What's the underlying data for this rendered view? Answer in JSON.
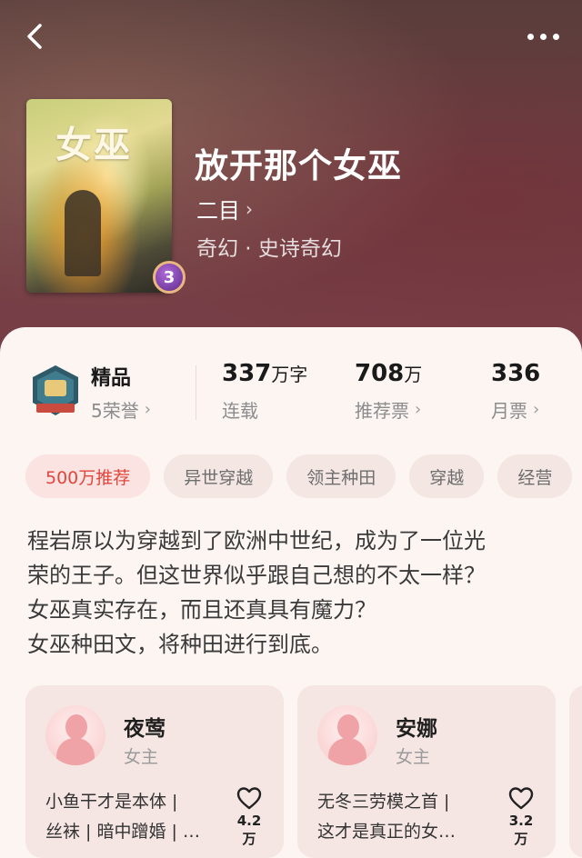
{
  "header": {
    "back_icon": "chevron-left-icon",
    "more_icon": "more-dots-icon"
  },
  "book": {
    "cover_title": "女巫",
    "rank": "3",
    "title": "放开那个女巫",
    "author": "二目",
    "genre": "奇幻 · 史诗奇幻"
  },
  "stats": {
    "honor": {
      "title": "精品",
      "sub": "5荣誉"
    },
    "words": {
      "value": "337",
      "unit": "万字",
      "label": "连载"
    },
    "recommend": {
      "value": "708",
      "unit": "万",
      "label": "推荐票"
    },
    "monthly": {
      "value": "336",
      "label": "月票"
    }
  },
  "tags": [
    "500万推荐",
    "异世穿越",
    "领主种田",
    "穿越",
    "经营"
  ],
  "description": [
    "程岩原以为穿越到了欧洲中世纪，成为了一位光",
    "荣的王子。但这世界似乎跟自己想的不太一样？",
    "女巫真实存在，而且还真具有魔力？",
    "女巫种田文，将种田进行到底。"
  ],
  "characters": [
    {
      "name": "夜莺",
      "role": "女主",
      "desc_line1": "小鱼干才是本体 |",
      "desc_line2": "丝袜 | 暗中蹭婚 | …",
      "likes": "4.2万"
    },
    {
      "name": "安娜",
      "role": "女主",
      "desc_line1": "无冬三劳模之首 |",
      "desc_line2": "这才是真正的女…",
      "likes": "3.2万"
    }
  ],
  "colors": {
    "accent": "#e0463d",
    "hero_bg": "#6b3f43",
    "sheet_bg": "#fcf5f2"
  }
}
